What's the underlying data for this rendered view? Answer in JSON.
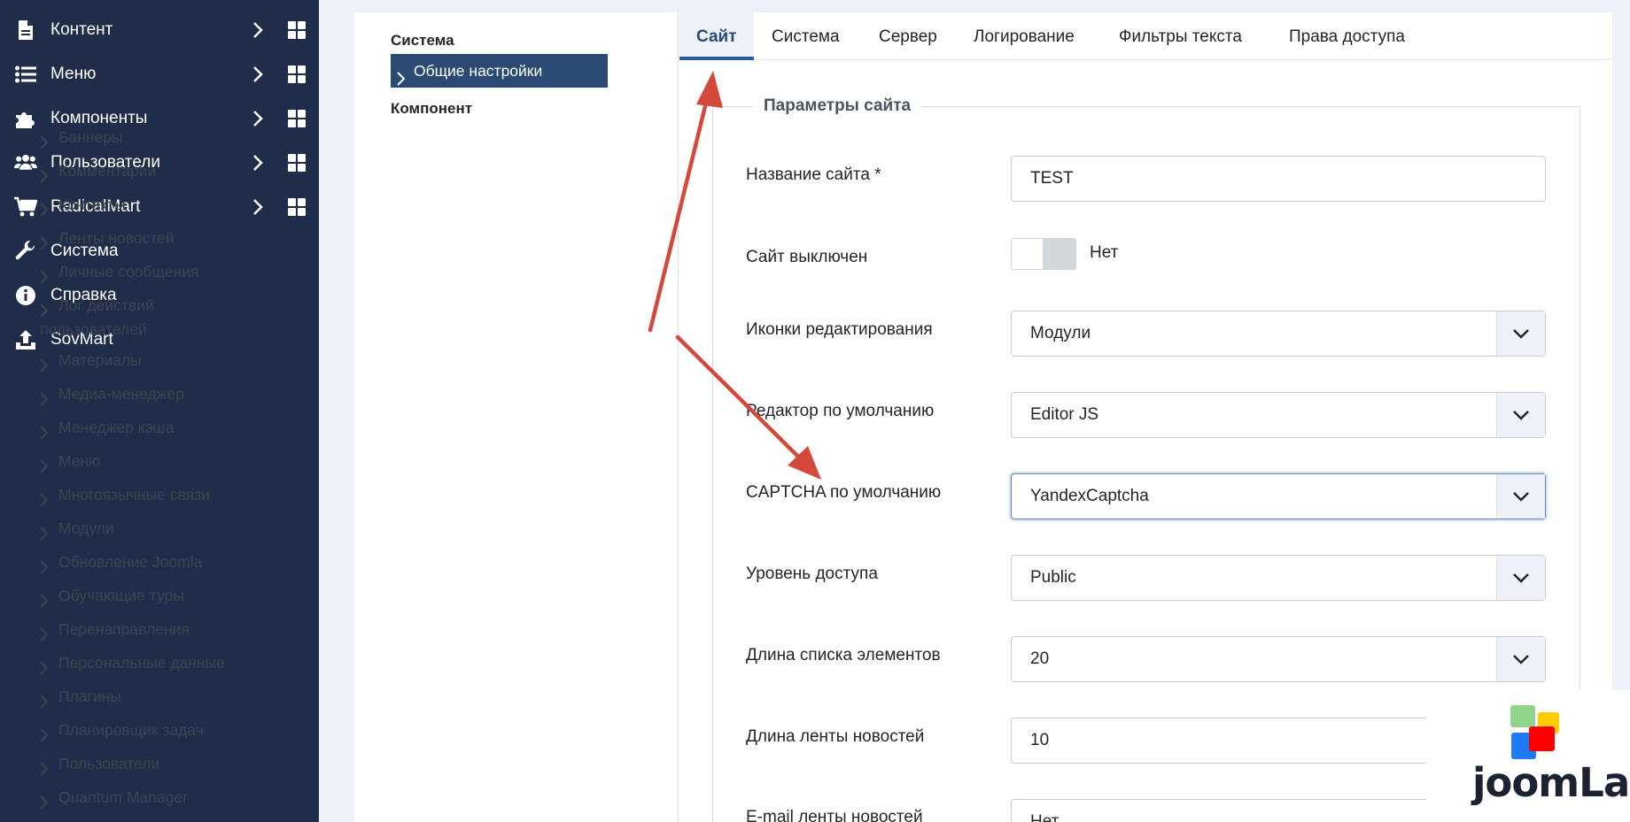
{
  "sidebar": {
    "items": [
      {
        "label": "Контент",
        "icon": "file-icon",
        "has_chevron": true
      },
      {
        "label": "Меню",
        "icon": "list-icon",
        "has_chevron": true
      },
      {
        "label": "Компоненты",
        "icon": "puzzle-icon",
        "has_chevron": true
      },
      {
        "label": "Пользователи",
        "icon": "users-icon",
        "has_chevron": true
      },
      {
        "label": "RadicalMart",
        "icon": "cart-icon",
        "has_chevron": true
      },
      {
        "label": "Система",
        "icon": "wrench-icon",
        "has_chevron": false
      },
      {
        "label": "Справка",
        "icon": "info-icon",
        "has_chevron": false
      },
      {
        "label": "SovMart",
        "icon": "upload-icon",
        "has_chevron": false
      }
    ]
  },
  "tree": {
    "system_heading": "Система",
    "active_item": "Общие настройки",
    "component_heading": "Компонент",
    "items": [
      "Баннеры",
      "Комментарии",
      "Контакты",
      "Ленты новостей",
      "Личные сообщения",
      "Лог действий",
      "Материалы",
      "Медиа-менеджер",
      "Менеджер кэша",
      "Меню",
      "Многоязычные связи",
      "Модули",
      "Обновление Joomla",
      "Обучающие туры",
      "Перенаправления",
      "Персональные данные",
      "Плагины",
      "Планировщик задач",
      "Пользователи",
      "Quantum Manager"
    ],
    "item_continuation": "пользователей"
  },
  "tabs": [
    "Сайт",
    "Система",
    "Сервер",
    "Логирование",
    "Фильтры текста",
    "Права доступа"
  ],
  "fieldset": {
    "legend": "Параметры сайта",
    "fields": {
      "site_name": {
        "label": "Название сайта *",
        "value": "TEST"
      },
      "site_offline": {
        "label": "Сайт выключен",
        "value": "Нет"
      },
      "edit_icons": {
        "label": "Иконки редактирования",
        "value": "Модули"
      },
      "default_editor": {
        "label": "Редактор по умолчанию",
        "value": "Editor JS"
      },
      "default_captcha": {
        "label": "CAPTCHA по умолчанию",
        "value": "YandexCaptcha"
      },
      "access_level": {
        "label": "Уровень доступа",
        "value": "Public"
      },
      "list_length": {
        "label": "Длина списка элементов",
        "value": "20"
      },
      "feed_length": {
        "label": "Длина ленты новостей",
        "value": "10"
      },
      "feed_email": {
        "label": "E-mail ленты новостей",
        "value": "Нет"
      }
    }
  },
  "watermark": {
    "text": "joomLab"
  },
  "colors": {
    "sidebar_bg": "#1f2d4a",
    "active_tree_bg": "#2a4a74",
    "arrow": "#d4493b",
    "tab_active_border": "#2a5d9f"
  }
}
